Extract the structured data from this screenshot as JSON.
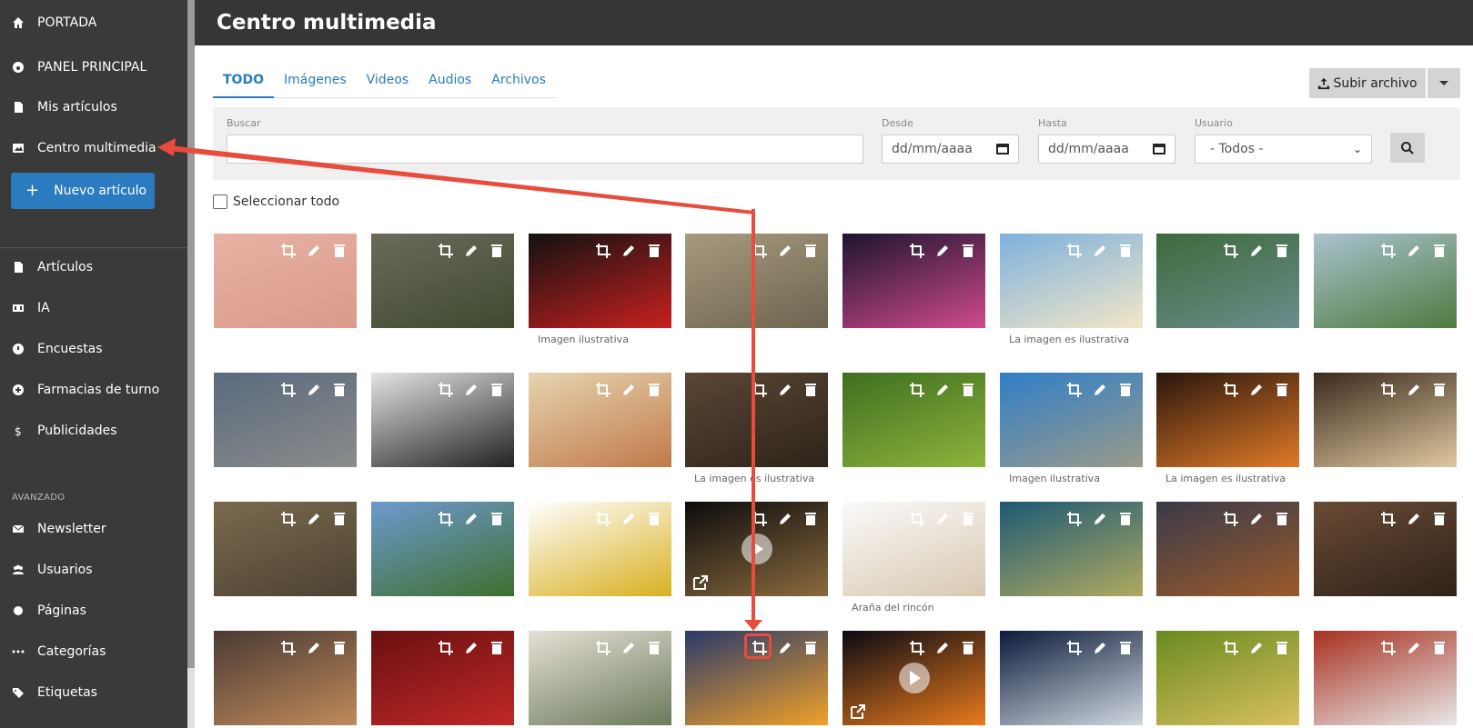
{
  "sidebar": {
    "items_top": [
      {
        "label": "PORTADA",
        "icon": "home-icon"
      },
      {
        "label": "PANEL PRINCIPAL",
        "icon": "dashboard-icon"
      },
      {
        "label": "Mis artículos",
        "icon": "file-icon"
      },
      {
        "label": "Centro multimedia",
        "icon": "image-icon"
      }
    ],
    "new_article_label": "Nuevo artículo",
    "items_main": [
      {
        "label": "Artículos",
        "icon": "file-icon"
      },
      {
        "label": "IA",
        "icon": "ai-icon"
      },
      {
        "label": "Encuestas",
        "icon": "question-icon"
      },
      {
        "label": "Farmacias de turno",
        "icon": "plus-circle-icon"
      },
      {
        "label": "Publicidades",
        "icon": "dollar-icon"
      }
    ],
    "section_advanced": "AVANZADO",
    "items_advanced": [
      {
        "label": "Newsletter",
        "icon": "envelope-icon"
      },
      {
        "label": "Usuarios",
        "icon": "users-icon"
      },
      {
        "label": "Páginas",
        "icon": "circle-icon"
      },
      {
        "label": "Categorías",
        "icon": "dots-icon"
      },
      {
        "label": "Etiquetas",
        "icon": "tag-icon"
      }
    ]
  },
  "header": {
    "title": "Centro multimedia"
  },
  "tabs": [
    {
      "label": "TODO",
      "active": true
    },
    {
      "label": "Imágenes",
      "active": false
    },
    {
      "label": "Videos",
      "active": false
    },
    {
      "label": "Audios",
      "active": false
    },
    {
      "label": "Archivos",
      "active": false
    }
  ],
  "upload_label": "Subir archivo",
  "filters": {
    "search_label": "Buscar",
    "search_value": "",
    "from_label": "Desde",
    "from_placeholder": "dd/mm/aaaa",
    "to_label": "Hasta",
    "to_placeholder": "dd/mm/aaaa",
    "user_label": "Usuario",
    "user_value": "- Todos -"
  },
  "select_all_label": "Seleccionar todo",
  "media_grid": {
    "items": [
      {
        "caption": "",
        "type": "image",
        "palette": [
          "#e8b2a4",
          "#d99a8a"
        ]
      },
      {
        "caption": "",
        "type": "image",
        "palette": [
          "#6b6a5a",
          "#3f4a2f"
        ]
      },
      {
        "caption": "Imagen ilustrativa",
        "type": "image",
        "palette": [
          "#111111",
          "#c82020"
        ]
      },
      {
        "caption": "",
        "type": "image",
        "palette": [
          "#a69a7e",
          "#6e6450"
        ]
      },
      {
        "caption": "",
        "type": "image",
        "palette": [
          "#1c1430",
          "#d04a8c"
        ]
      },
      {
        "caption": "La imagen es ilustrativa",
        "type": "image",
        "palette": [
          "#7db1dd",
          "#f3e6c8"
        ]
      },
      {
        "caption": "",
        "type": "image",
        "palette": [
          "#3c6b3c",
          "#6c8c8c"
        ]
      },
      {
        "caption": "",
        "type": "image",
        "palette": [
          "#a9c3cf",
          "#4f7a3f"
        ]
      },
      {
        "caption": "",
        "type": "image",
        "palette": [
          "#5a6a7e",
          "#8a8c8a"
        ]
      },
      {
        "caption": "",
        "type": "image",
        "palette": [
          "#e4e4e4",
          "#222222"
        ]
      },
      {
        "caption": "",
        "type": "image",
        "palette": [
          "#e6d4b0",
          "#c07a4a"
        ]
      },
      {
        "caption": "La imagen es ilustrativa",
        "type": "image",
        "palette": [
          "#5a4634",
          "#2e241a"
        ]
      },
      {
        "caption": "",
        "type": "image",
        "palette": [
          "#3f6e20",
          "#8db43c"
        ]
      },
      {
        "caption": "Imagen ilustrativa",
        "type": "image",
        "palette": [
          "#2f7fc8",
          "#9a9a8a"
        ]
      },
      {
        "caption": "La imagen es ilustrativa",
        "type": "image",
        "palette": [
          "#2a160c",
          "#e07a28"
        ]
      },
      {
        "caption": "",
        "type": "image",
        "palette": [
          "#3a2a1c",
          "#e0c8a0"
        ]
      },
      {
        "caption": "",
        "type": "image",
        "palette": [
          "#7a6a4e",
          "#4c4232"
        ]
      },
      {
        "caption": "",
        "type": "image",
        "palette": [
          "#6d9acf",
          "#3f6f2f"
        ]
      },
      {
        "caption": "",
        "type": "image",
        "palette": [
          "#ffffff",
          "#d8b020"
        ]
      },
      {
        "caption": "",
        "type": "video",
        "palette": [
          "#0c0c0c",
          "#8a6a3e"
        ]
      },
      {
        "caption": "Araña del rincón",
        "type": "image",
        "palette": [
          "#fafafa",
          "#d8c8b0"
        ]
      },
      {
        "caption": "",
        "type": "image",
        "palette": [
          "#1c5a74",
          "#b0a860"
        ]
      },
      {
        "caption": "",
        "type": "image",
        "palette": [
          "#3a3a4a",
          "#9a5a2a"
        ]
      },
      {
        "caption": "",
        "type": "image",
        "palette": [
          "#6a4a34",
          "#2e2218"
        ]
      },
      {
        "caption": "",
        "type": "image",
        "palette": [
          "#4a3a34",
          "#c08a5a"
        ]
      },
      {
        "caption": "",
        "type": "image",
        "palette": [
          "#6a1010",
          "#c02828"
        ]
      },
      {
        "caption": "",
        "type": "image",
        "palette": [
          "#e6e0d6",
          "#6a7a5a"
        ]
      },
      {
        "caption": "",
        "type": "image",
        "palette": [
          "#2a3a6a",
          "#f0a028"
        ]
      },
      {
        "caption": "",
        "type": "video",
        "palette": [
          "#0a0a14",
          "#e87a1c"
        ]
      },
      {
        "caption": "",
        "type": "image",
        "palette": [
          "#0c1a3a",
          "#d0d8e0"
        ]
      },
      {
        "caption": "",
        "type": "image",
        "palette": [
          "#6a8a20",
          "#d8c060"
        ]
      },
      {
        "caption": "",
        "type": "image",
        "palette": [
          "#a83020",
          "#e8e8e8"
        ]
      }
    ]
  },
  "colors": {
    "accent": "#2b7bc0",
    "annotation": "#e74c3c",
    "sidebar": "#3a3a3a"
  }
}
